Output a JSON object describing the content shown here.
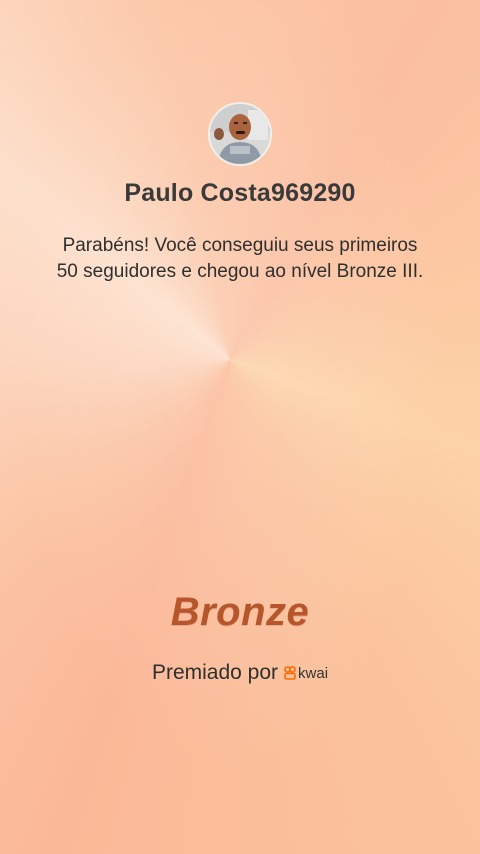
{
  "profile": {
    "avatar_icon": "user-photo-avatar",
    "username": "Paulo Costa969290"
  },
  "message": "Parabéns! Você conseguiu seus primeiros 50 seguidores e chegou ao nível Bronze III.",
  "tier": {
    "label": "Bronze",
    "color": "#b7552b"
  },
  "footer": {
    "awarded_label": "Premiado por",
    "brand_text": "kwai",
    "brand_icon": "kwai-logo-icon",
    "brand_color": "#ff6a00"
  }
}
